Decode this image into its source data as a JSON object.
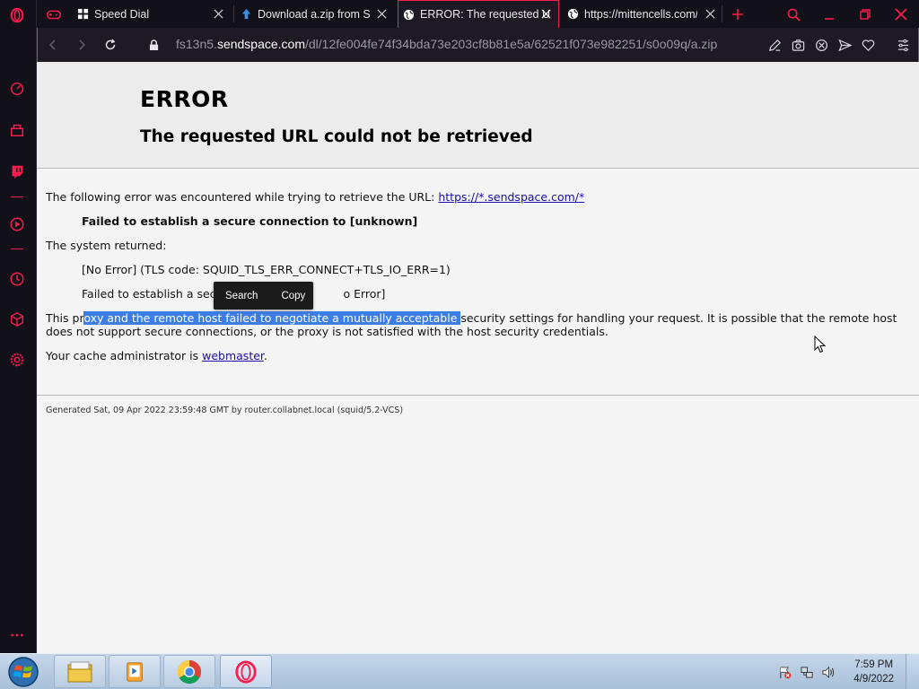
{
  "browser": {
    "tabs": [
      {
        "label": "Speed Dial",
        "icon": "grid-icon",
        "active": false
      },
      {
        "label": "Download a.zip from Se",
        "icon": "upload-arrow-icon",
        "active": false
      },
      {
        "label": "ERROR: The requested U",
        "icon": "globe-icon",
        "active": true
      },
      {
        "label": "https://mittencells.com/",
        "icon": "globe-icon",
        "active": false
      }
    ],
    "url_prefix": "fs13n5.",
    "url_host": "sendspace.com",
    "url_path": "/dl/12fe004fe74f34bda73e203cf8b81e5a/62521f073e982251/s0o09q/a.zip",
    "accent_color": "#fa1e4e"
  },
  "page": {
    "title": "ERROR",
    "subtitle": "The requested URL could not be retrieved",
    "intro_text": "The following error was encountered while trying to retrieve the URL: ",
    "intro_link": "https://*.sendspace.com/*",
    "failure_message": "Failed to establish a secure connection to [unknown]",
    "system_returned_label": "The system returned:",
    "system_error_1": "[No Error] (TLS code: SQUID_TLS_ERR_CONNECT+TLS_IO_ERR=1)",
    "system_error_2_start": "Failed to establish a secu",
    "system_error_2_end": "o Error]",
    "explanation_start": "This pr",
    "explanation_selected": "oxy and the remote host failed to negotiate a mutually acceptable ",
    "explanation_end": "security settings for handling your request. It is possible that the remote host does not support secure connections, or the proxy is not satisfied with the host security credentials.",
    "admin_text": "Your cache administrator is ",
    "admin_link": "webmaster",
    "admin_suffix": ".",
    "footer": "Generated Sat, 09 Apr 2022 23:59:48 GMT by router.collabnet.local (squid/5.2-VCS)"
  },
  "popup": {
    "search_label": "Search",
    "copy_label": "Copy"
  },
  "taskbar": {
    "apps": [
      "file-explorer-icon",
      "media-player-icon",
      "chrome-icon",
      "opera-icon"
    ],
    "time": "7:59 PM",
    "date": "4/9/2022"
  }
}
